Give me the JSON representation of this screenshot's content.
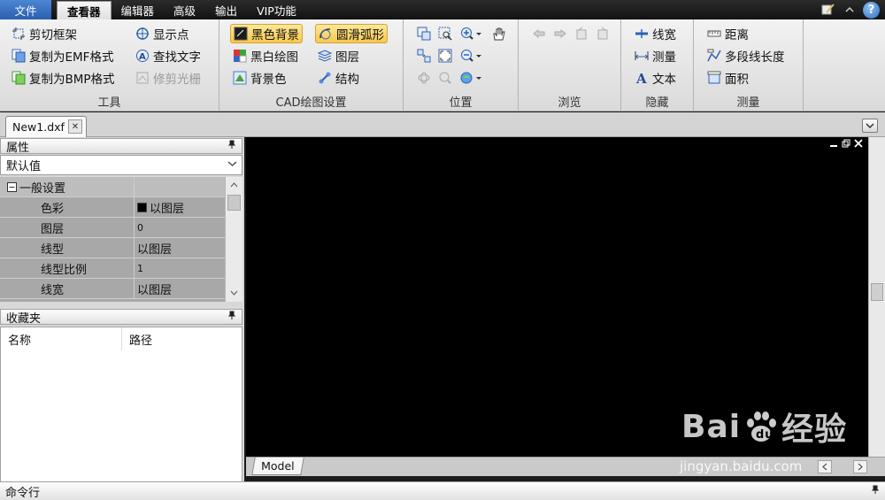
{
  "menubar": {
    "tabs": [
      "文件",
      "查看器",
      "编辑器",
      "高级",
      "输出",
      "VIP功能"
    ],
    "active_tab": "查看器",
    "help_label": "?"
  },
  "ribbon": {
    "groups": [
      {
        "label": "工具",
        "items": [
          "剪切框架",
          "复制为EMF格式",
          "复制为BMP格式",
          "显示点",
          "查找文字",
          "修剪光栅"
        ]
      },
      {
        "label": "CAD绘图设置",
        "items": [
          "黑色背景",
          "黑白绘图",
          "背景色",
          "圆滑弧形",
          "图层",
          "结构"
        ]
      },
      {
        "label": "位置"
      },
      {
        "label": "浏览"
      },
      {
        "label": "隐藏",
        "items": [
          "线宽",
          "测量",
          "文本"
        ]
      },
      {
        "label": "测量",
        "items": [
          "距离",
          "多段线长度",
          "面积"
        ]
      }
    ]
  },
  "document_tab": {
    "label": "New1.dxf",
    "close_label": "✕"
  },
  "properties_panel": {
    "title": "属性",
    "preset": "默认值",
    "category": "一般设置",
    "rows": [
      {
        "key": "色彩",
        "value": "以图层"
      },
      {
        "key": "图层",
        "value": "0"
      },
      {
        "key": "线型",
        "value": "以图层"
      },
      {
        "key": "线型比例",
        "value": "1"
      },
      {
        "key": "线宽",
        "value": "以图层"
      }
    ]
  },
  "favorites_panel": {
    "title": "收藏夹",
    "columns": [
      "名称",
      "路径"
    ]
  },
  "canvas": {
    "layout_tab": "Model",
    "background": "#000000"
  },
  "command_line": {
    "title": "命令行"
  },
  "watermark": {
    "logo_left": "Bai",
    "logo_right": "经验",
    "url": "jingyan.baidu.com"
  },
  "colors": {
    "menubar": "#1a1a1a",
    "file_tab": "#2f66b8",
    "highlight": "#f9d46a",
    "ribbon": "#e6e6e6"
  }
}
